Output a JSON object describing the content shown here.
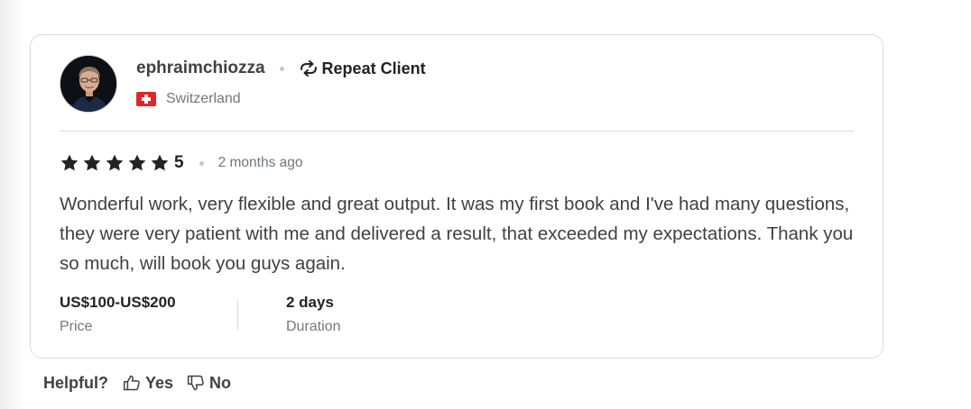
{
  "review": {
    "username": "ephraimchiozza",
    "badge_label": "Repeat Client",
    "country": "Switzerland",
    "rating": "5",
    "star_count": 5,
    "time_ago": "2 months ago",
    "text": "Wonderful work, very flexible and great output. It was my first book and I've had many questions, they were very patient with me and delivered a result, that exceeded my expectations. Thank you so much, will book you guys again.",
    "price_value": "US$100-US$200",
    "price_label": "Price",
    "duration_value": "2 days",
    "duration_label": "Duration"
  },
  "helpful": {
    "question": "Helpful?",
    "yes_label": "Yes",
    "no_label": "No"
  },
  "colors": {
    "star": "#222325",
    "flag_red": "#e0262c",
    "border": "#dadbdd",
    "muted_text": "#74767e"
  },
  "icons": {
    "badge": "repeat-icon",
    "flag": "switzerland-flag-icon",
    "yes": "thumbs-up-icon",
    "no": "thumbs-down-icon"
  }
}
